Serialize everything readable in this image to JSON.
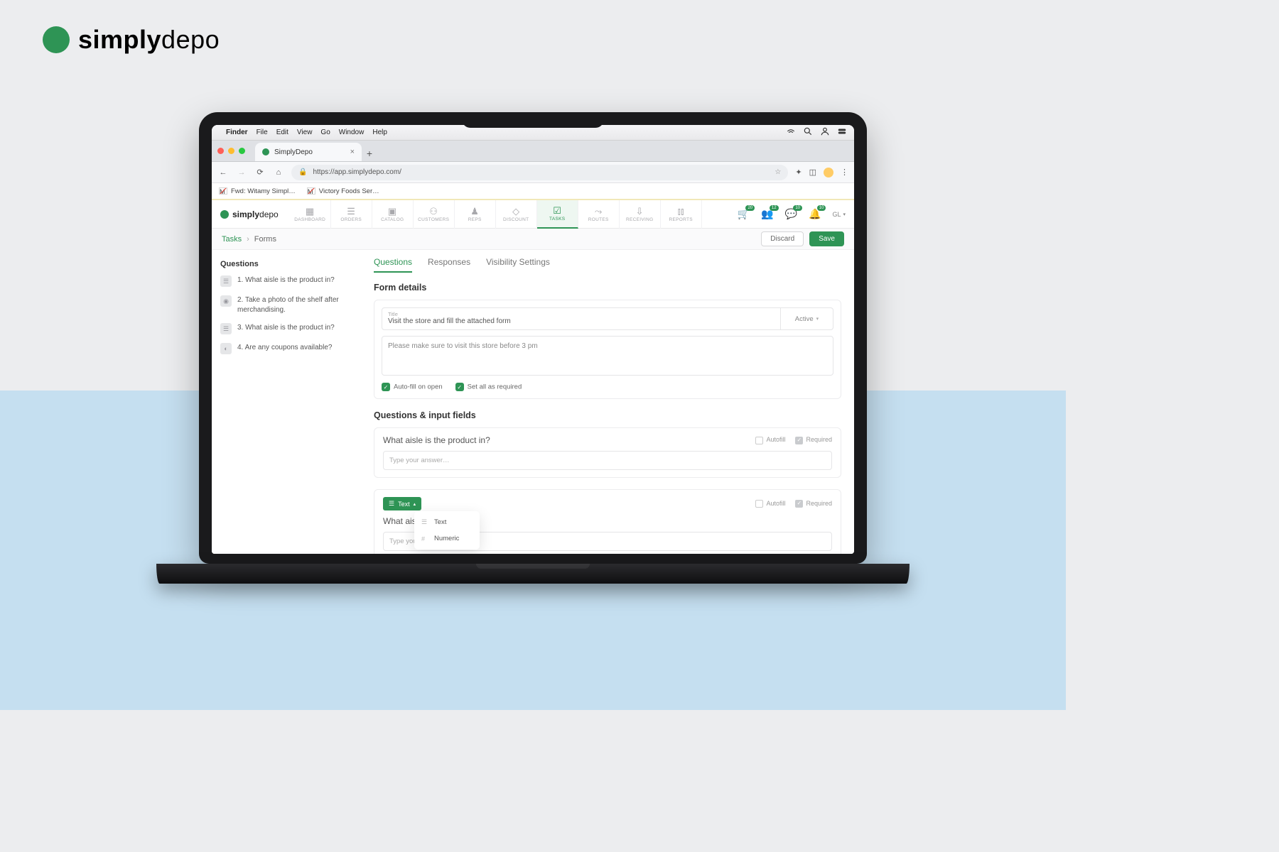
{
  "brand": {
    "bold": "simply",
    "light": "depo"
  },
  "mac_menu": {
    "app": "Finder",
    "items": [
      "File",
      "Edit",
      "View",
      "Go",
      "Window",
      "Help"
    ]
  },
  "browser_tab": {
    "title": "SimplyDepo"
  },
  "url": "https://app.simplydepo.com/",
  "bookmarks": {
    "bm1": "Fwd: Witamy Simpl…",
    "bm2": "Victory Foods Ser…"
  },
  "app_logo": {
    "bold": "simply",
    "light": "depo"
  },
  "nav": [
    {
      "label": "DASHBOARD"
    },
    {
      "label": "ORDERS"
    },
    {
      "label": "CATALOG"
    },
    {
      "label": "CUSTOMERS"
    },
    {
      "label": "REPS"
    },
    {
      "label": "DISCOUNT"
    },
    {
      "label": "TASKS"
    },
    {
      "label": "ROUTES"
    },
    {
      "label": "RECEIVING"
    },
    {
      "label": "REPORTS"
    }
  ],
  "header_badges": {
    "cart": "20",
    "users": "12",
    "chat": "10",
    "bell": "10"
  },
  "user_initials": "GL",
  "crumb": {
    "root": "Tasks",
    "leaf": "Forms",
    "discard": "Discard",
    "save": "Save"
  },
  "side": {
    "heading": "Questions",
    "items": [
      {
        "n": "1.",
        "t": "What aisle is the product in?"
      },
      {
        "n": "2.",
        "t": "Take a photo of the shelf after merchandising."
      },
      {
        "n": "3.",
        "t": "What aisle is the product in?"
      },
      {
        "n": "4.",
        "t": "Are any coupons available?"
      }
    ]
  },
  "tabs": {
    "t1": "Questions",
    "t2": "Responses",
    "t3": "Visibility Settings"
  },
  "form_details": {
    "heading": "Form details",
    "title_label": "Title",
    "title_value": "Visit the store and fill the attached form",
    "status": "Active",
    "description": "Please make sure to visit this store before 3 pm",
    "chk_autofill": "Auto-fill on open",
    "chk_required": "Set all as required"
  },
  "qif_heading": "Questions & input fields",
  "q1": {
    "title": "What aisle is the product in?",
    "autofill": "Autofill",
    "required": "Required",
    "placeholder": "Type your answer…"
  },
  "q2": {
    "type_label": "Text",
    "title_partial": "What aisle",
    "autofill": "Autofill",
    "required": "Required",
    "placeholder": "Type your a",
    "dd_text": "Text",
    "dd_numeric": "Numeric"
  }
}
